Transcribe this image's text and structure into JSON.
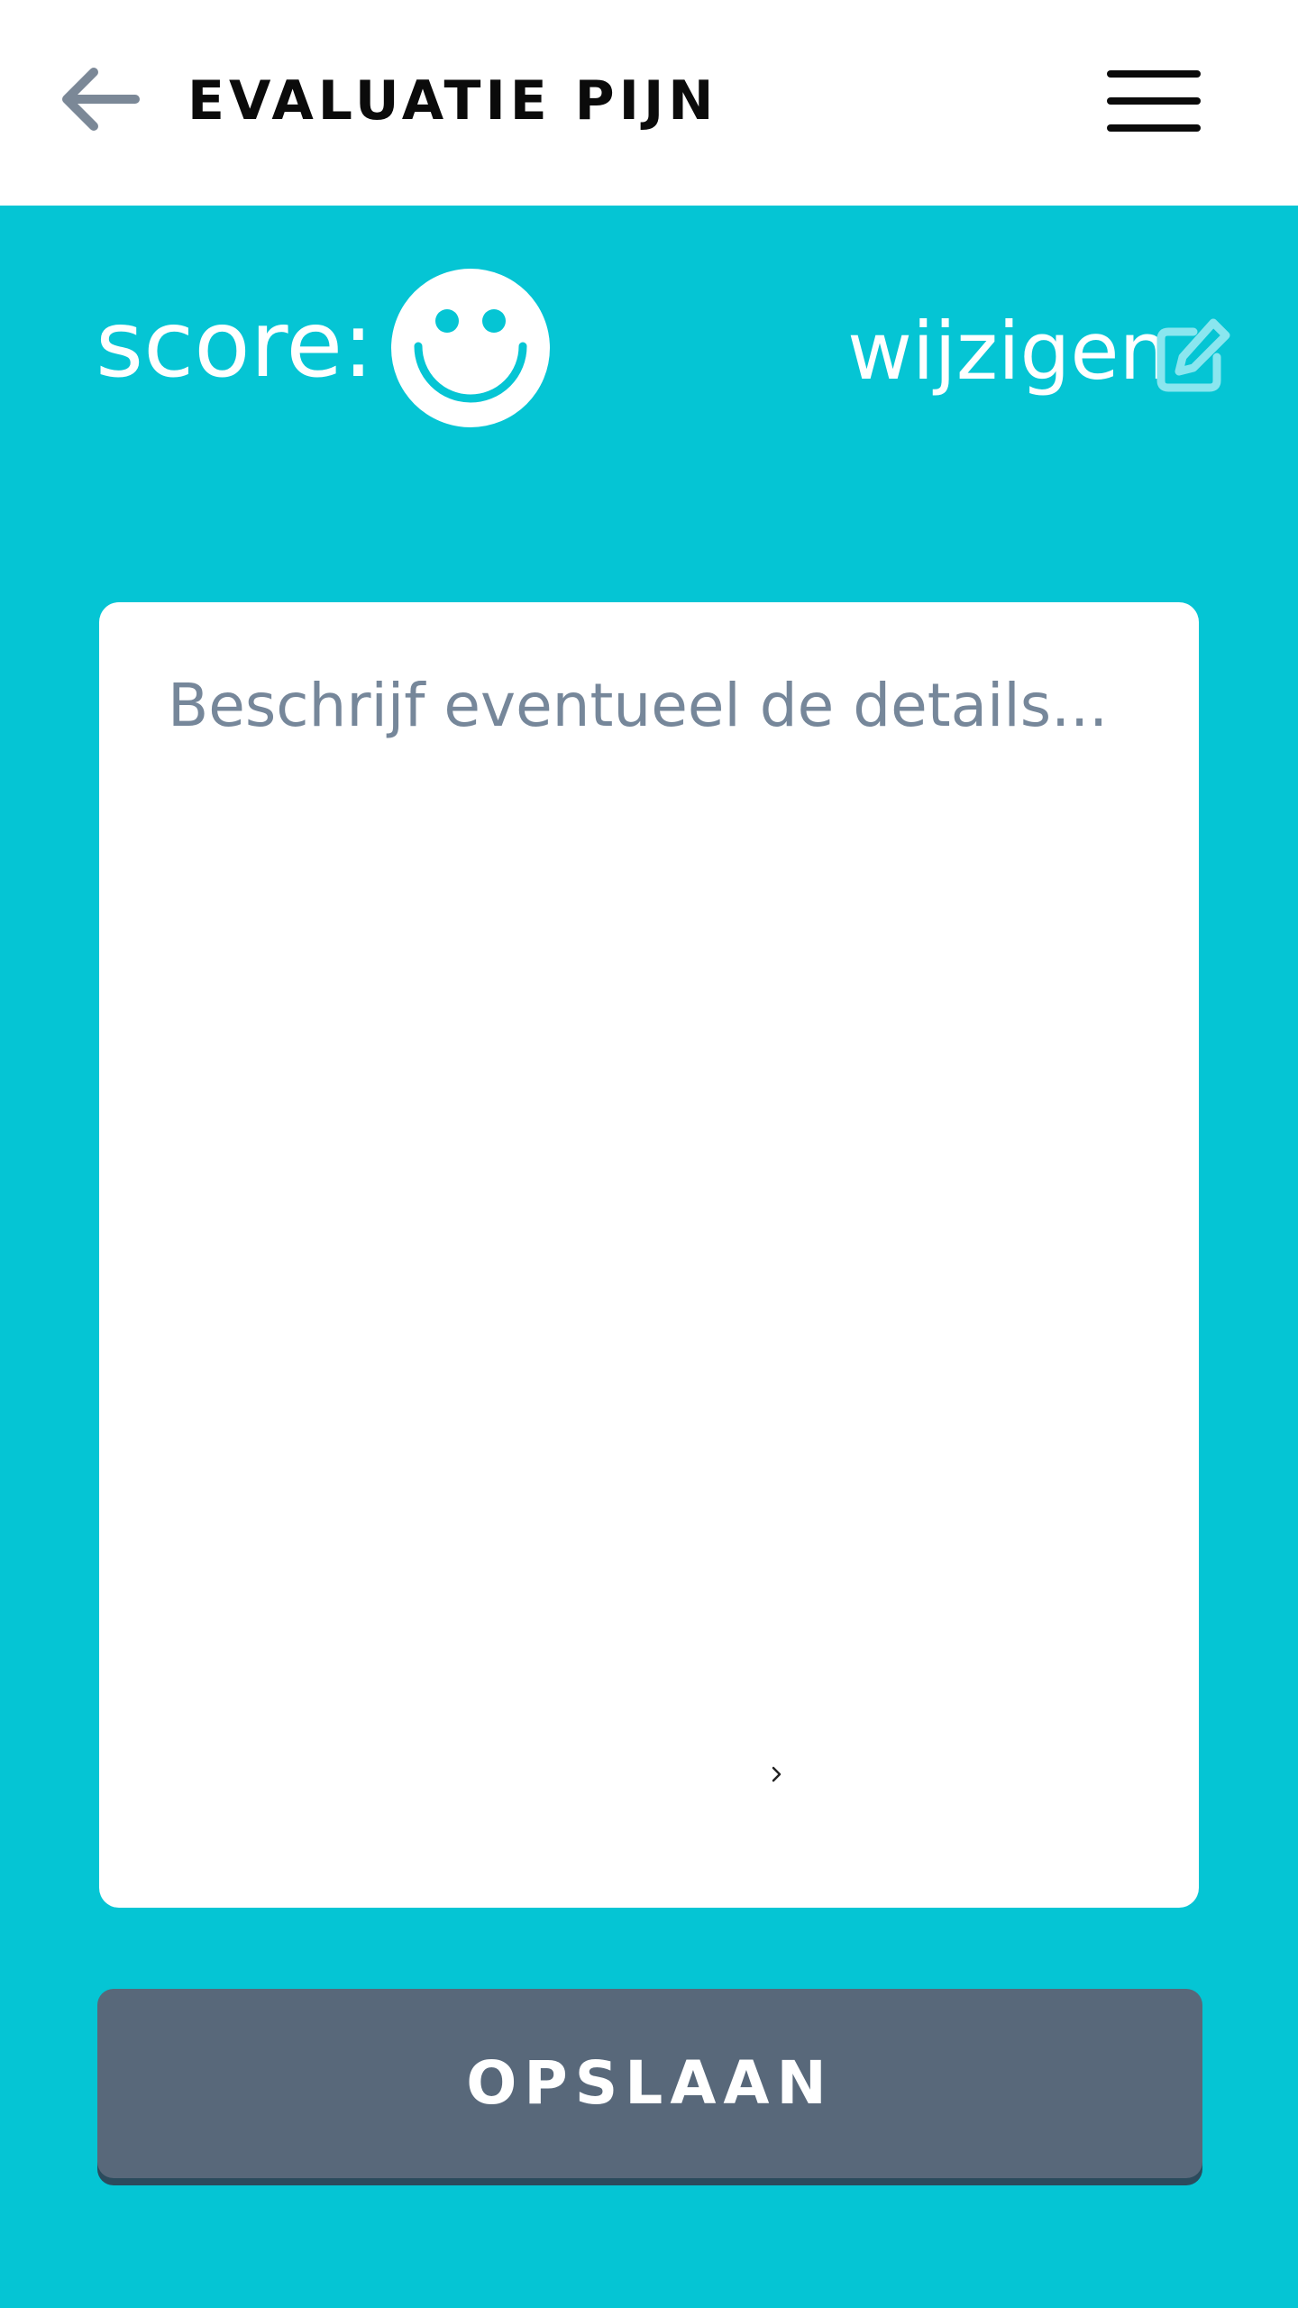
{
  "header": {
    "title": "EVALUATIE PIJN",
    "back_icon": "arrow-left-icon",
    "menu_icon": "hamburger-menu-icon"
  },
  "score": {
    "label": "score:",
    "icon": "smiley-face-icon",
    "edit_label": "wijzigen",
    "edit_icon": "edit-pencil-icon"
  },
  "details": {
    "placeholder": "Beschrijf eventueel de details...",
    "value": ""
  },
  "actions": {
    "save_label": "OPSLAAN"
  },
  "colors": {
    "background": "#05c5d4",
    "header": "#ffffff",
    "button": "#58687a",
    "button_shadow": "#2b4b5d",
    "placeholder": "#76879a",
    "icon_gray": "#7b8897"
  }
}
